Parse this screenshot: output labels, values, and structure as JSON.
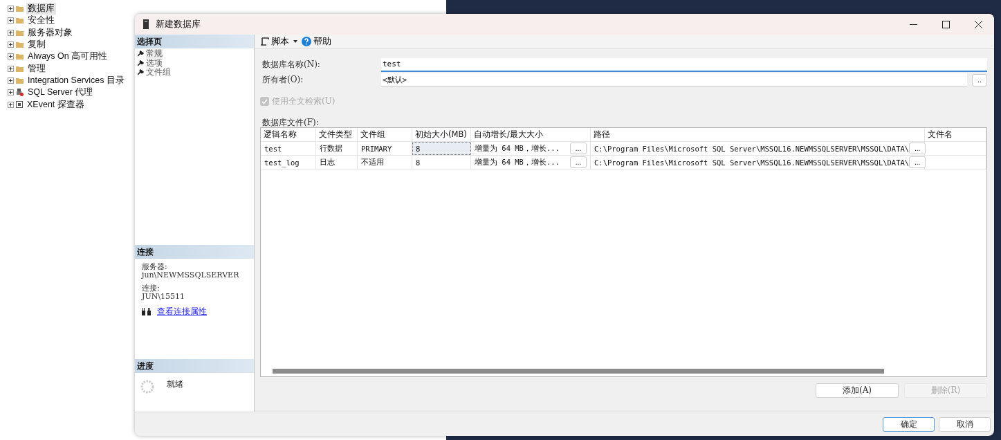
{
  "explorer_tree": [
    {
      "label": "数据库",
      "kind": "folder",
      "selected": true
    },
    {
      "label": "安全性",
      "kind": "folder",
      "selected": false
    },
    {
      "label": "服务器对象",
      "kind": "folder",
      "selected": false
    },
    {
      "label": "复制",
      "kind": "folder",
      "selected": false
    },
    {
      "label": "Always On 高可用性",
      "kind": "folder",
      "selected": false
    },
    {
      "label": "管理",
      "kind": "folder",
      "selected": false
    },
    {
      "label": "Integration Services 目录",
      "kind": "folder",
      "selected": false
    },
    {
      "label": "SQL Server 代理",
      "kind": "agent",
      "selected": false
    },
    {
      "label": "XEvent 探查器",
      "kind": "xevent",
      "selected": false
    }
  ],
  "dialog": {
    "title": "新建数据库",
    "sidebar": {
      "header": "选择页",
      "pages": [
        {
          "label": "常规",
          "selected": true
        },
        {
          "label": "选项",
          "selected": false
        },
        {
          "label": "文件组",
          "selected": false
        }
      ]
    },
    "connection": {
      "header": "连接",
      "items": [
        {
          "label": "服务器:",
          "value": "jun\\NEWMSSQLSERVER"
        },
        {
          "label": "连接:",
          "value": "JUN\\15511"
        }
      ],
      "link": "查看连接属性"
    },
    "progress": {
      "header": "进度",
      "status": "就绪"
    },
    "toolbar": {
      "script": "脚本",
      "help": "帮助"
    },
    "form": {
      "name_label": "数据库名称(N):",
      "name_value": "test",
      "owner_label": "所有者(O):",
      "owner_value": "<默认>",
      "owner_button": "..",
      "fulltext": {
        "label": "使用全文检索(U)",
        "checked": true,
        "disabled": true
      }
    },
    "files": {
      "label": "数据库文件(F):",
      "columns": [
        "逻辑名称",
        "文件类型",
        "文件组",
        "初始大小(MB)",
        "自动增长/最大大小",
        "路径",
        "文件名"
      ],
      "rows": [
        {
          "cells": [
            "test",
            "行数据",
            "PRIMARY",
            "8",
            "增量为 64 MB，增长...",
            "C:\\Program Files\\Microsoft SQL Server\\MSSQL16.NEWMSSQLSERVER\\MSSQL\\DATA\\"
          ],
          "size_focused": true,
          "growth_button": "...",
          "path_button": "..."
        },
        {
          "size_focused": false,
          "cells": [
            "test_log",
            "日志",
            "不适用",
            "8",
            "增量为 64 MB，增长...",
            "C:\\Program Files\\Microsoft SQL Server\\MSSQL16.NEWMSSQLSERVER\\MSSQL\\DATA\\"
          ],
          "growth_button": "...",
          "path_button": "..."
        }
      ],
      "add_button": {
        "label": "添加(A)",
        "disabled": false
      },
      "remove_button": {
        "label": "删除(R)",
        "disabled": true
      }
    },
    "footer": {
      "ok": {
        "label": "确定",
        "default": true
      },
      "cancel": {
        "label": "取消",
        "default": false
      }
    }
  }
}
